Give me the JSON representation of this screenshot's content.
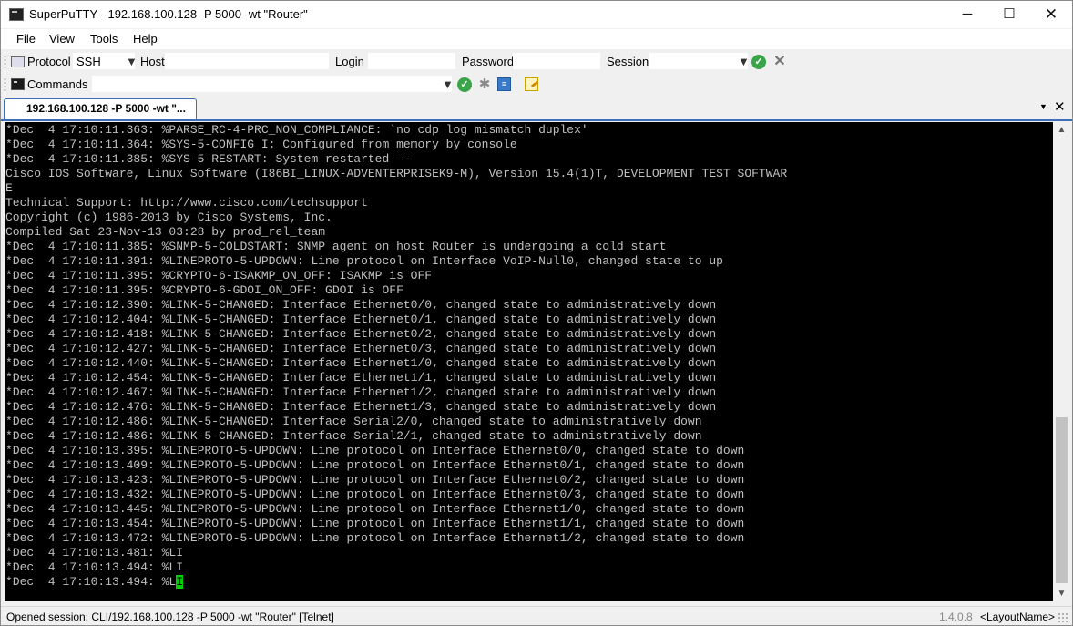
{
  "window": {
    "title": "SuperPuTTY - 192.168.100.128 -P 5000 -wt \"Router\"",
    "minimize": "─",
    "maximize": "☐",
    "close": "✕"
  },
  "menu": {
    "items": [
      {
        "label": "File"
      },
      {
        "label": "View"
      },
      {
        "label": "Tools"
      },
      {
        "label": "Help"
      }
    ]
  },
  "connect_toolbar": {
    "protocol_label": "Protocol",
    "protocol_value": "SSH",
    "host_label": "Host",
    "host_value": "",
    "login_label": "Login",
    "login_value": "",
    "password_label": "Password",
    "password_value": "",
    "session_label": "Session",
    "session_value": "",
    "connect_icon": "green-check-icon",
    "clear_icon": "gray-x-icon"
  },
  "commands_toolbar": {
    "label": "Commands",
    "command_value": "",
    "icons": [
      "green-check-icon",
      "gear-icon",
      "send-to-sessions-icon",
      "notepad-icon"
    ]
  },
  "tabs": [
    {
      "label": "192.168.100.128 -P 5000 -wt \"...",
      "active": true
    }
  ],
  "tab_menu_glyph": "▼",
  "tab_close_glyph": "✕",
  "terminal": {
    "background": "#000000",
    "foreground": "#c0c0c0",
    "cursor_color": "#00d000",
    "lines": [
      "*Dec  4 17:10:11.363: %PARSE_RC-4-PRC_NON_COMPLIANCE: `no cdp log mismatch duplex'",
      "*Dec  4 17:10:11.364: %SYS-5-CONFIG_I: Configured from memory by console",
      "*Dec  4 17:10:11.385: %SYS-5-RESTART: System restarted --",
      "Cisco IOS Software, Linux Software (I86BI_LINUX-ADVENTERPRISEK9-M), Version 15.4(1)T, DEVELOPMENT TEST SOFTWAR",
      "E",
      "Technical Support: http://www.cisco.com/techsupport",
      "Copyright (c) 1986-2013 by Cisco Systems, Inc.",
      "Compiled Sat 23-Nov-13 03:28 by prod_rel_team",
      "*Dec  4 17:10:11.385: %SNMP-5-COLDSTART: SNMP agent on host Router is undergoing a cold start",
      "*Dec  4 17:10:11.391: %LINEPROTO-5-UPDOWN: Line protocol on Interface VoIP-Null0, changed state to up",
      "*Dec  4 17:10:11.395: %CRYPTO-6-ISAKMP_ON_OFF: ISAKMP is OFF",
      "*Dec  4 17:10:11.395: %CRYPTO-6-GDOI_ON_OFF: GDOI is OFF",
      "*Dec  4 17:10:12.390: %LINK-5-CHANGED: Interface Ethernet0/0, changed state to administratively down",
      "*Dec  4 17:10:12.404: %LINK-5-CHANGED: Interface Ethernet0/1, changed state to administratively down",
      "*Dec  4 17:10:12.418: %LINK-5-CHANGED: Interface Ethernet0/2, changed state to administratively down",
      "*Dec  4 17:10:12.427: %LINK-5-CHANGED: Interface Ethernet0/3, changed state to administratively down",
      "*Dec  4 17:10:12.440: %LINK-5-CHANGED: Interface Ethernet1/0, changed state to administratively down",
      "*Dec  4 17:10:12.454: %LINK-5-CHANGED: Interface Ethernet1/1, changed state to administratively down",
      "*Dec  4 17:10:12.467: %LINK-5-CHANGED: Interface Ethernet1/2, changed state to administratively down",
      "*Dec  4 17:10:12.476: %LINK-5-CHANGED: Interface Ethernet1/3, changed state to administratively down",
      "*Dec  4 17:10:12.486: %LINK-5-CHANGED: Interface Serial2/0, changed state to administratively down",
      "*Dec  4 17:10:12.486: %LINK-5-CHANGED: Interface Serial2/1, changed state to administratively down",
      "*Dec  4 17:10:13.395: %LINEPROTO-5-UPDOWN: Line protocol on Interface Ethernet0/0, changed state to down",
      "*Dec  4 17:10:13.409: %LINEPROTO-5-UPDOWN: Line protocol on Interface Ethernet0/1, changed state to down",
      "*Dec  4 17:10:13.423: %LINEPROTO-5-UPDOWN: Line protocol on Interface Ethernet0/2, changed state to down",
      "*Dec  4 17:10:13.432: %LINEPROTO-5-UPDOWN: Line protocol on Interface Ethernet0/3, changed state to down",
      "*Dec  4 17:10:13.445: %LINEPROTO-5-UPDOWN: Line protocol on Interface Ethernet1/0, changed state to down",
      "*Dec  4 17:10:13.454: %LINEPROTO-5-UPDOWN: Line protocol on Interface Ethernet1/1, changed state to down",
      "*Dec  4 17:10:13.472: %LINEPROTO-5-UPDOWN: Line protocol on Interface Ethernet1/2, changed state to down",
      "*Dec  4 17:10:13.481: %LI",
      "*Dec  4 17:10:13.494: %LI"
    ],
    "prompt_line": "*Dec  4 17:10:13.494: %L",
    "cursor_char": "I"
  },
  "scrollbar": {
    "up_glyph": "▲",
    "down_glyph": "▼"
  },
  "statusbar": {
    "session_text": "Opened session: CLI/192.168.100.128 -P 5000 -wt \"Router\" [Telnet]",
    "version": "1.4.0.8",
    "layout_name": "<LayoutName>"
  }
}
